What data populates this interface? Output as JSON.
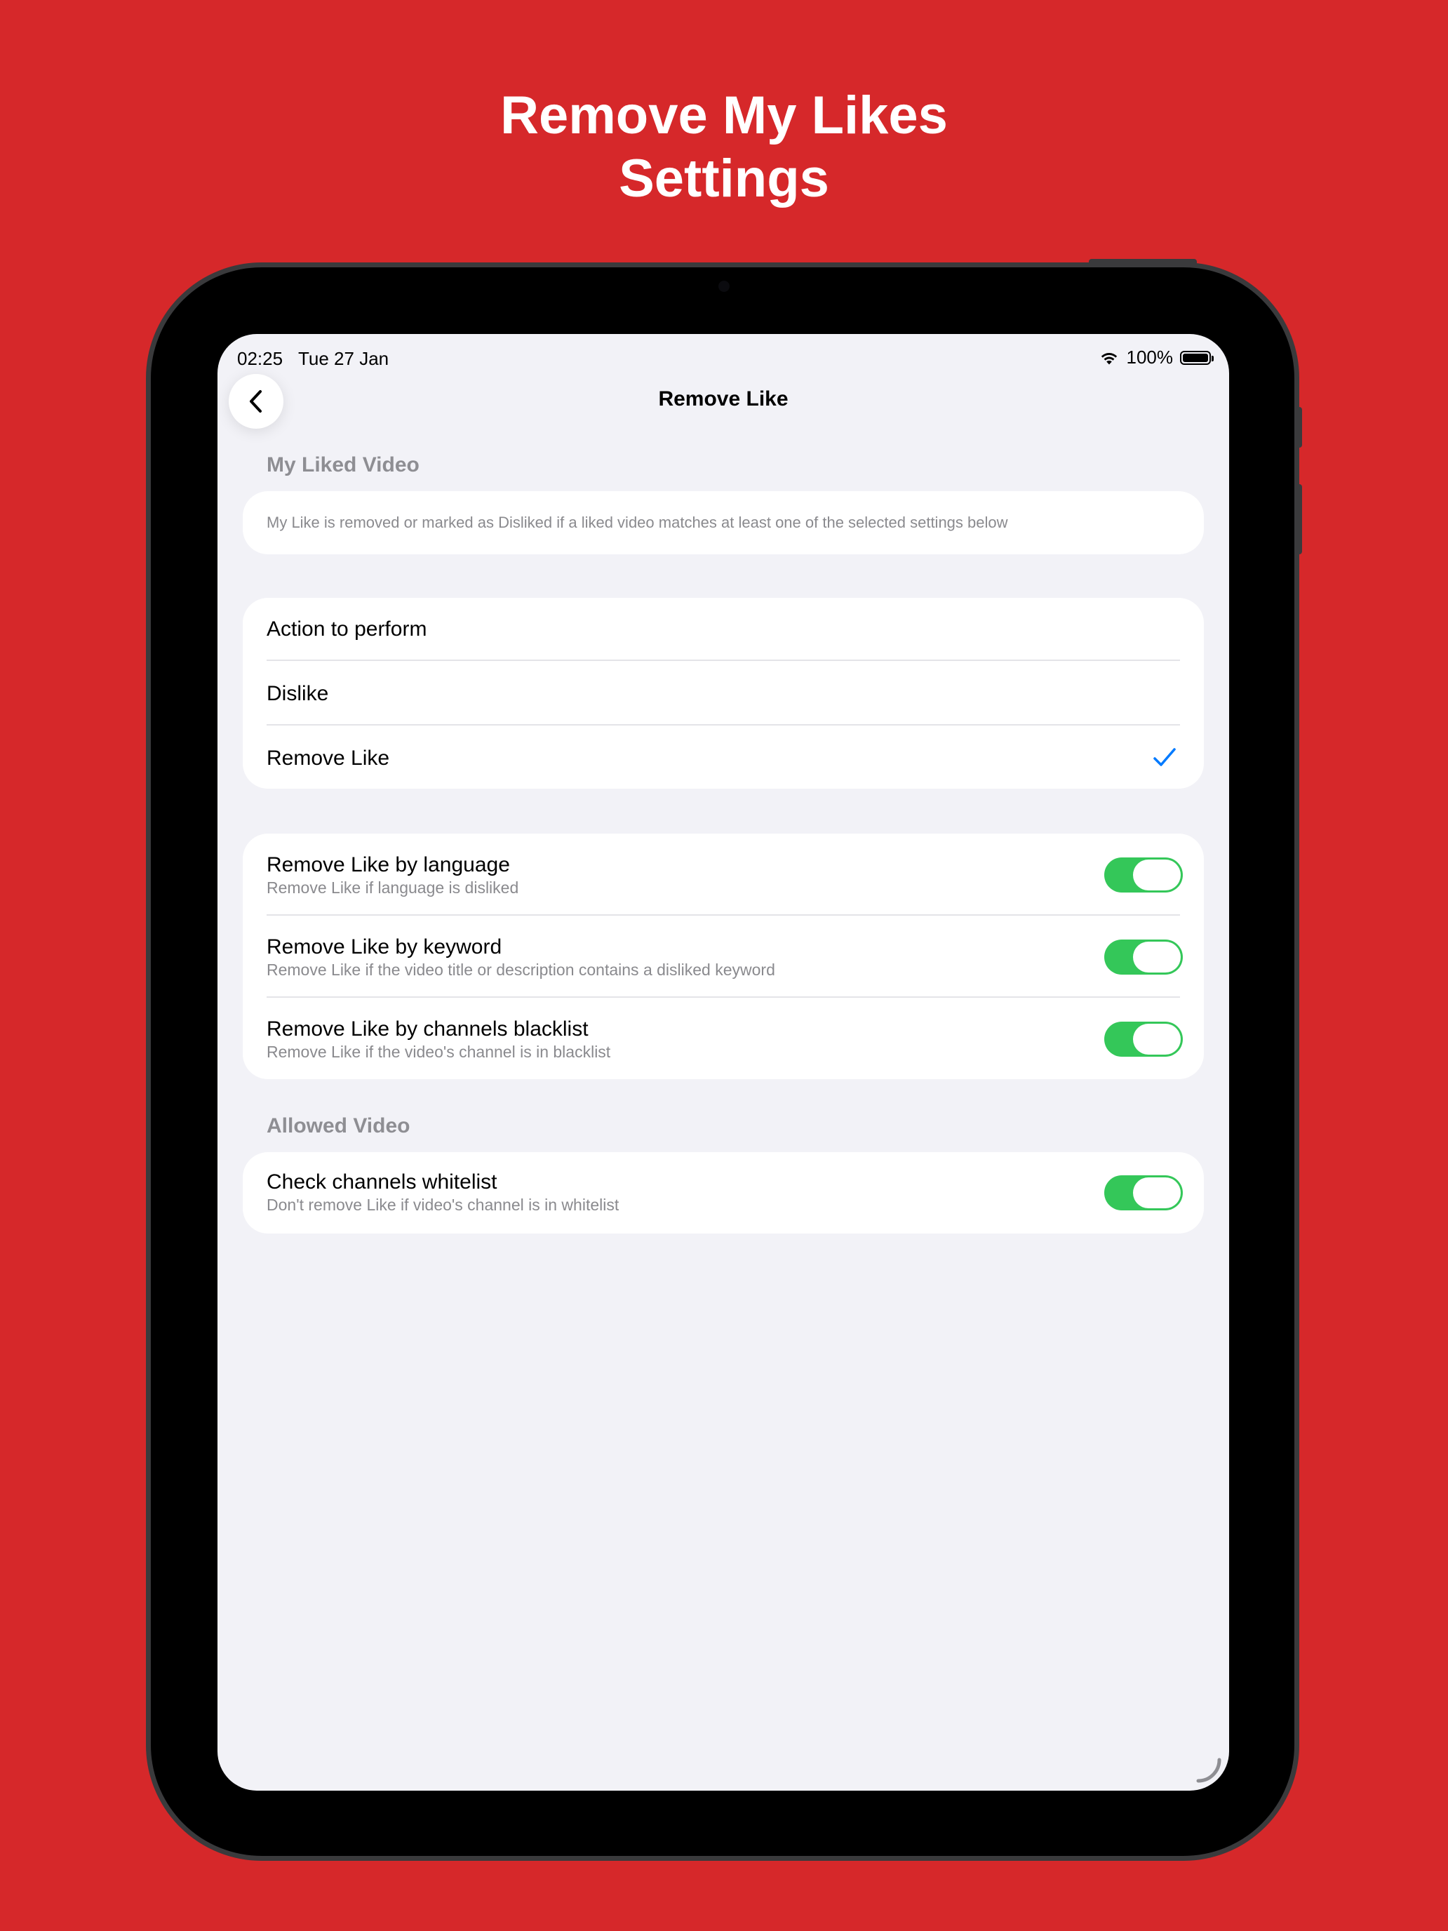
{
  "promo": {
    "title_line1": "Remove My Likes",
    "title_line2": "Settings",
    "background_color": "#d6282a"
  },
  "status_bar": {
    "time": "02:25",
    "date": "Tue 27 Jan",
    "battery_percent": "100%",
    "battery_level": 1.0,
    "wifi_icon": "wifi-icon",
    "battery_icon": "battery-icon"
  },
  "nav": {
    "back_icon": "chevron-left-icon",
    "title": "Remove Like"
  },
  "liked_video_section": {
    "header": "My Liked Video",
    "info_text": "My Like is removed or marked as Disliked if a liked video matches at least one of the selected settings below"
  },
  "action_section": {
    "header": "Action to perform",
    "options": [
      {
        "label": "Dislike",
        "selected": false
      },
      {
        "label": "Remove Like",
        "selected": true
      }
    ],
    "check_icon": "checkmark-icon",
    "check_color": "#007aff"
  },
  "rules_section": {
    "items": [
      {
        "title": "Remove Like by language",
        "subtitle": "Remove Like if language is disliked",
        "enabled": true
      },
      {
        "title": "Remove Like by keyword",
        "subtitle": "Remove Like if the video title or description contains a disliked keyword",
        "enabled": true
      },
      {
        "title": "Remove Like by channels blacklist",
        "subtitle": "Remove Like if the video's channel is in blacklist",
        "enabled": true
      }
    ]
  },
  "allowed_section": {
    "header": "Allowed Video",
    "items": [
      {
        "title": "Check channels whitelist",
        "subtitle": "Don't remove Like if video's channel is in whitelist",
        "enabled": true
      }
    ]
  },
  "colors": {
    "toggle_on": "#34c759",
    "screen_bg": "#f2f2f7",
    "card_bg": "#ffffff",
    "secondary_text": "#8e8e93"
  }
}
